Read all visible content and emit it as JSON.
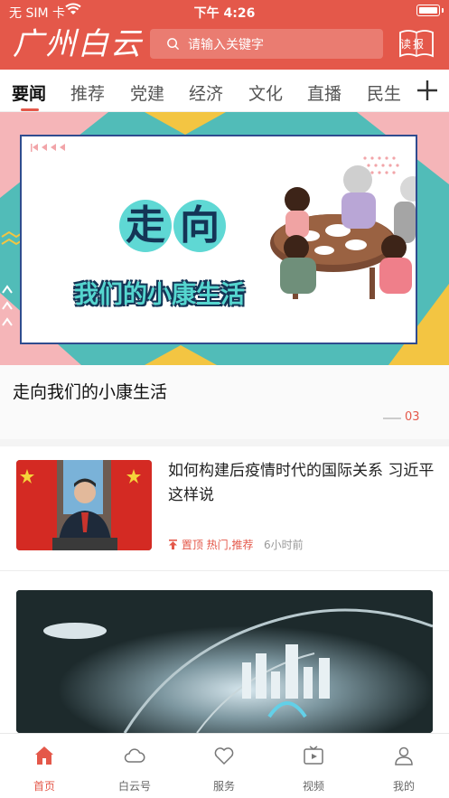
{
  "status_bar": {
    "carrier": "无 SIM 卡",
    "time": "下午 4:26"
  },
  "header": {
    "logo": "广州白云",
    "search_placeholder": "请输入关键字",
    "reader_label": "读报"
  },
  "tabs": [
    {
      "label": "要闻",
      "active": true
    },
    {
      "label": "推荐",
      "active": false
    },
    {
      "label": "党建",
      "active": false
    },
    {
      "label": "经济",
      "active": false
    },
    {
      "label": "文化",
      "active": false
    },
    {
      "label": "直播",
      "active": false
    },
    {
      "label": "民生",
      "active": false
    }
  ],
  "banner": {
    "poster_line1": [
      "走",
      "向"
    ],
    "poster_line2": "我们的小康生活",
    "title": "走向我们的小康生活",
    "page_indicator": "03"
  },
  "news": [
    {
      "title": "如何构建后疫情时代的国际关系 习近平这样说",
      "pin_label": "置顶",
      "tags": "热门,推荐",
      "time": "6小时前"
    }
  ],
  "bottom_nav": [
    {
      "label": "首页",
      "icon": "home-icon",
      "active": true
    },
    {
      "label": "白云号",
      "icon": "cloud-icon",
      "active": false
    },
    {
      "label": "服务",
      "icon": "heart-icon",
      "active": false
    },
    {
      "label": "视频",
      "icon": "tv-play-icon",
      "active": false
    },
    {
      "label": "我的",
      "icon": "user-icon",
      "active": false
    }
  ],
  "colors": {
    "brand": "#e4584a",
    "banner_teal": "#51bcb8",
    "banner_navy": "#143556"
  }
}
